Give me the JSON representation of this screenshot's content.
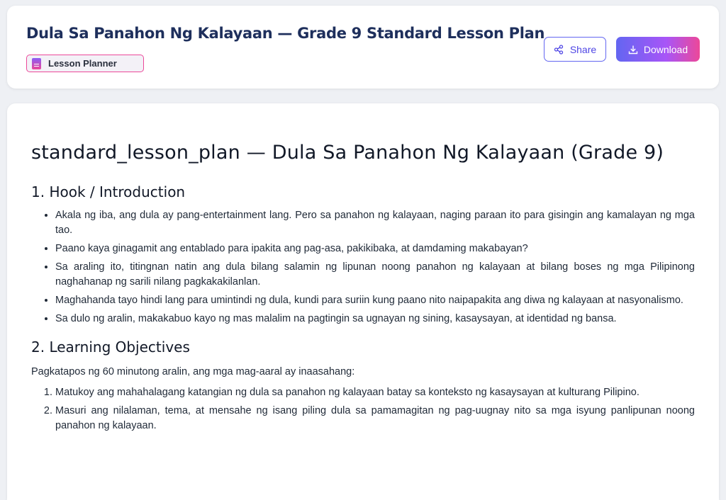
{
  "header": {
    "title": "Dula Sa Panahon Ng Kalayaan — Grade 9 Standard Lesson Plan",
    "badge_label": "Lesson Planner",
    "share_label": "Share",
    "download_label": "Download"
  },
  "document": {
    "title": "standard_lesson_plan — Dula Sa Panahon Ng Kalayaan (Grade 9)",
    "sections": {
      "hook": {
        "heading": "1. Hook / Introduction",
        "items": [
          "Akala ng iba, ang dula ay pang-entertainment lang. Pero sa panahon ng kalayaan, naging paraan ito para gisingin ang kamalayan ng mga tao.",
          "Paano kaya ginagamit ang entablado para ipakita ang pag-asa, pakikibaka, at damdaming makabayan?",
          "Sa araling ito, titingnan natin ang dula bilang salamin ng lipunan noong panahon ng kalayaan at bilang boses ng mga Pilipinong naghahanap ng sarili nilang pagkakakilanlan.",
          "Maghahanda tayo hindi lang para umintindi ng dula, kundi para suriin kung paano nito naipapakita ang diwa ng kalayaan at nasyonalismo.",
          "Sa dulo ng aralin, makakabuo kayo ng mas malalim na pagtingin sa ugnayan ng sining, kasaysayan, at identidad ng bansa."
        ]
      },
      "objectives": {
        "heading": "2. Learning Objectives",
        "intro": "Pagkatapos ng 60 minutong aralin, ang mga mag-aaral ay inaasahang:",
        "items": [
          "Matukoy ang mahahalagang katangian ng dula sa panahon ng kalayaan batay sa konteksto ng kasaysayan at kulturang Pilipino.",
          "Masuri ang nilalaman, tema, at mensahe ng isang piling dula sa pamamagitan ng pag-uugnay nito sa mga isyung panlipunan noong panahon ng kalayaan."
        ]
      }
    }
  },
  "colors": {
    "title": "#1e2f5c",
    "accent_start": "#6366f1",
    "accent_mid": "#a855f7",
    "accent_end": "#ec4899"
  },
  "icons": {
    "badge": "document-icon",
    "share": "share-icon",
    "download": "download-icon"
  }
}
